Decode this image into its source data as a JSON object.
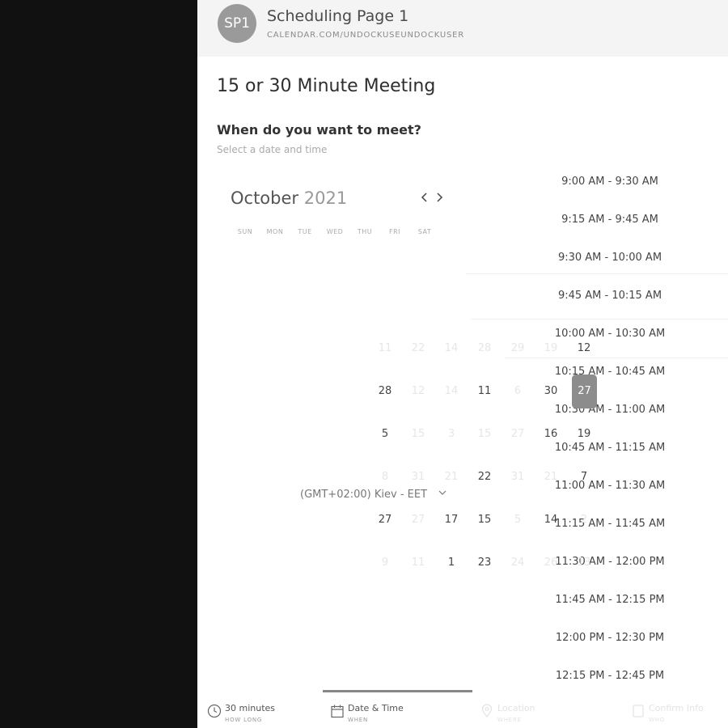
{
  "header": {
    "avatar_initials": "SP1",
    "title": "Scheduling Page 1",
    "url": "CALENDAR.COM/UNDOCKUSEUNDOCKUSER"
  },
  "meeting": {
    "title": "15 or 30 Minute Meeting",
    "question": "When do you want to meet?",
    "subtitle": "Select a date and time"
  },
  "calendar": {
    "month": "October",
    "year": "2021",
    "prev_icon": "chevron-left-icon",
    "next_icon": "chevron-right-icon",
    "weekdays": [
      "SUN",
      "MON",
      "TUE",
      "WED",
      "THU",
      "FRI",
      "SAT"
    ],
    "rows": [
      [
        {
          "t": "11",
          "f": true
        },
        {
          "t": "22",
          "f": true
        },
        {
          "t": "14",
          "f": true
        },
        {
          "t": "28",
          "f": true
        },
        {
          "t": "29",
          "f": true
        },
        {
          "t": "19",
          "f": true
        },
        {
          "t": "12",
          "f": false
        }
      ],
      [
        {
          "t": "28",
          "f": false
        },
        {
          "t": "12",
          "f": true
        },
        {
          "t": "14",
          "f": true
        },
        {
          "t": "11",
          "f": false
        },
        {
          "t": "6",
          "f": true
        },
        {
          "t": "30",
          "f": false
        },
        {
          "t": "27",
          "f": false,
          "sel": true
        }
      ],
      [
        {
          "t": "5",
          "f": false
        },
        {
          "t": "15",
          "f": true
        },
        {
          "t": "3",
          "f": true
        },
        {
          "t": "15",
          "f": true
        },
        {
          "t": "27",
          "f": true
        },
        {
          "t": "16",
          "f": false
        },
        {
          "t": "19",
          "f": false
        }
      ],
      [
        {
          "t": "8",
          "f": true
        },
        {
          "t": "31",
          "f": true
        },
        {
          "t": "21",
          "f": true
        },
        {
          "t": "22",
          "f": false
        },
        {
          "t": "31",
          "f": true
        },
        {
          "t": "21",
          "f": true
        },
        {
          "t": "7",
          "f": false
        }
      ],
      [
        {
          "t": "27",
          "f": false
        },
        {
          "t": "27",
          "f": true
        },
        {
          "t": "17",
          "f": false
        },
        {
          "t": "15",
          "f": false
        },
        {
          "t": "5",
          "f": true
        },
        {
          "t": "14",
          "f": false
        },
        {
          "t": "2",
          "f": true
        }
      ],
      [
        {
          "t": "9",
          "f": true
        },
        {
          "t": "11",
          "f": true
        },
        {
          "t": "1",
          "f": false
        },
        {
          "t": "23",
          "f": false
        },
        {
          "t": "24",
          "f": true
        },
        {
          "t": "26",
          "f": true
        },
        {
          "t": "13",
          "f": true
        }
      ]
    ]
  },
  "timezone": {
    "label": "(GMT+02:00) Kiev - EET",
    "chevron_icon": "chevron-down-icon"
  },
  "time_slots": [
    "9:00 AM - 9:30 AM",
    "9:15 AM - 9:45 AM",
    "9:30 AM - 10:00 AM",
    "9:45 AM - 10:15 AM",
    "10:00 AM - 10:30 AM",
    "10:15 AM - 10:45 AM",
    "10:30 AM - 11:00 AM",
    "10:45 AM - 11:15 AM",
    "11:00 AM - 11:30 AM",
    "11:15 AM - 11:45 AM",
    "11:30 AM - 12:00 PM",
    "11:45 AM - 12:15 PM",
    "12:00 PM - 12:30 PM",
    "12:15 PM - 12:45 PM"
  ],
  "steps": [
    {
      "label": "30 minutes",
      "sub": "HOW LONG",
      "icon": "clock-icon"
    },
    {
      "label": "Date & Time",
      "sub": "WHEN",
      "icon": "calendar-icon"
    },
    {
      "label": "Location",
      "sub": "WHERE",
      "icon": "location-pin-icon"
    },
    {
      "label": "Confirm Info",
      "sub": "WHO",
      "icon": "document-icon"
    }
  ]
}
